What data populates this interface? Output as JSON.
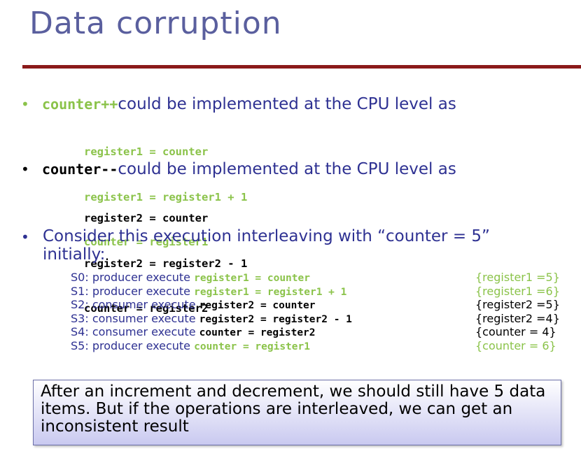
{
  "slide": {
    "title": "Data corruption",
    "bullets": [
      {
        "code": "counter++",
        "text": " could be implemented at the CPU level as",
        "lines": [
          "register1 = counter",
          "register1 = register1 + 1",
          "counter = register1"
        ]
      },
      {
        "code": "counter--",
        "text": " could be implemented at the CPU level as",
        "lines": [
          "register2 = counter",
          "register2 = register2 - 1",
          "counter = register2"
        ]
      }
    ],
    "consider": "Consider this execution interleaving with “counter = 5” initially:",
    "steps": [
      {
        "label": "S0: producer execute ",
        "code": "register1 = counter",
        "comment": "{register1 =5}",
        "color": "green"
      },
      {
        "label": "S1: producer execute ",
        "code": "register1 = register1 + 1",
        "comment": "{register1 =6}",
        "color": "green"
      },
      {
        "label": "S2: consumer execute ",
        "code": "register2 = counter",
        "comment": "{register2 =5}",
        "color": "black"
      },
      {
        "label": "S3: consumer execute ",
        "code": "register2 = register2 - 1",
        "comment": "{register2 =4}",
        "color": "black"
      },
      {
        "label": "S4: consumer execute ",
        "code": "counter = register2",
        "comment": "{counter = 4}",
        "color": "black"
      },
      {
        "label": "S5: producer execute ",
        "code": "counter = register1",
        "comment": "{counter = 6}",
        "color": "green"
      }
    ],
    "callout": "After an increment and decrement, we should still have 5 data items. But if the operations are interleaved, we can get an inconsistent result"
  },
  "colors": {
    "title": "#5a5f9e",
    "rule": "#8b1a1a",
    "navy": "#2e3192",
    "green": "#8bc34a"
  }
}
